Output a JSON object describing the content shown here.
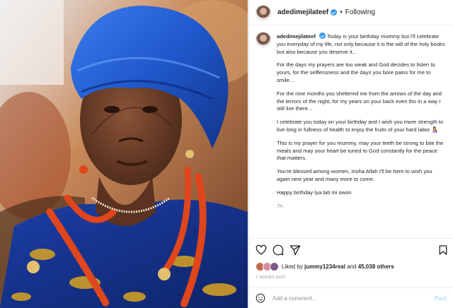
{
  "post": {
    "username": "adedimejilateef",
    "separator": "•",
    "follow_status": "Following",
    "caption_paragraphs": [
      "Today is your birthday mummy but I'll celebrate you everyday of my life, not only because it is the will of the holy books but also because you deserve it...",
      "For the days my prayers are too weak and God decides to listen to yours, for the selflessness and the days you bore pains for me to smile...",
      "For the nine months you sheltered me from the arrows of the day and the terrors of the night, for my years on your back even tho in a way I still live there...",
      "I celebrate you today on your birthday and I wish you more strength to live long in fullness of health to enjoy the fruits of your hard labor 🤱",
      "This is my prayer for you mummy, may your teeth be strong to bite the meals and may your heart be tuned to God constantly for the peace that matters.",
      "You're blessed among women, Insha Allah I'll be here to wish you again next year and many more to come.",
      "Happy birthday Iya lati mi owon"
    ],
    "caption_time": "7h",
    "likes": {
      "prefix": "Liked by",
      "user": "jummy1234real",
      "and": "and",
      "count": "45,038 others"
    },
    "posted_ago": "7 HOURS AGO",
    "add_comment_placeholder": "Add a comment...",
    "post_button": "Post"
  },
  "icons": [
    "heart-icon",
    "comment-icon",
    "share-icon",
    "bookmark-icon",
    "emoji-icon",
    "verified-icon"
  ],
  "colors": {
    "verified": "#3897f0",
    "post_button": "#b3dbff",
    "headwrap": "#1f57c9",
    "beads": "#e0461b"
  }
}
